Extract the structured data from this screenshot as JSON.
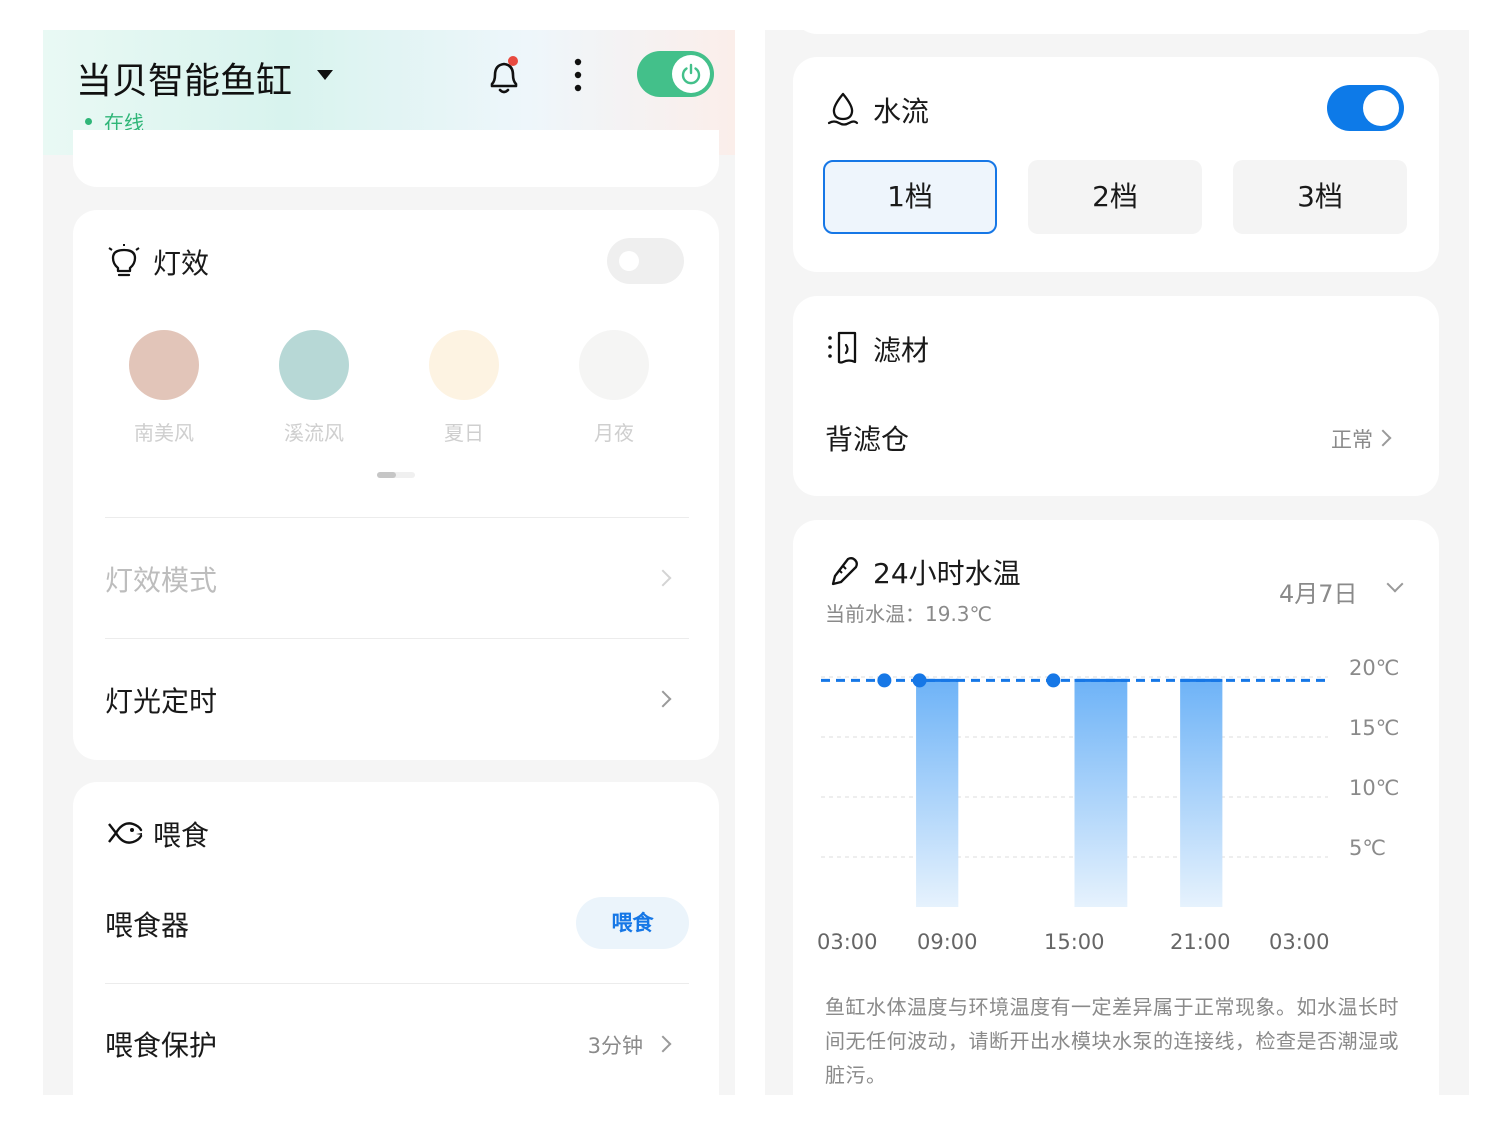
{
  "header": {
    "title": "当贝智能鱼缸",
    "status": "在线"
  },
  "light": {
    "title": "灯效",
    "presets": [
      {
        "label": "南美风",
        "color": "#e2c5b9"
      },
      {
        "label": "溪流风",
        "color": "#b7d8d6"
      },
      {
        "label": "夏日",
        "color": "#fdf3e2"
      },
      {
        "label": "月夜",
        "color": "#f5f5f4"
      }
    ],
    "mode_label": "灯效模式",
    "timer_label": "灯光定时"
  },
  "feeding": {
    "title": "喂食",
    "feeder_label": "喂食器",
    "feed_button": "喂食",
    "protection_label": "喂食保护",
    "protection_value": "3分钟"
  },
  "water_flow": {
    "title": "水流",
    "enabled": true,
    "levels": [
      "1档",
      "2档",
      "3档"
    ],
    "selected_level": "1档"
  },
  "filter": {
    "title": "滤材",
    "item_label": "背滤仓",
    "item_status": "正常"
  },
  "temperature": {
    "title": "24小时水温",
    "current": "当前水温：19.3℃",
    "date": "4月7日",
    "note": "鱼缸水体温度与环境温度有一定差异属于正常现象。如水温长时间无任何波动，请断开出水模块水泵的连接线，检查是否潮湿或脏污。"
  },
  "chart_data": {
    "type": "bar",
    "x": [
      "03:00",
      "09:00",
      "15:00",
      "21:00",
      "03:00"
    ],
    "y_ticks": [
      "20℃",
      "15℃",
      "10℃",
      "5℃"
    ],
    "ylim": [
      0,
      20
    ],
    "bars": [
      {
        "start": "06:30",
        "end": "08:30",
        "value": 19.3
      },
      {
        "start": "14:00",
        "end": "16:30",
        "value": 19.3
      },
      {
        "start": "19:00",
        "end": "21:00",
        "value": 19.3
      }
    ],
    "line_points": [
      {
        "x": "13:00",
        "value": 19.3
      },
      {
        "x": "05:00",
        "value": 19.3
      },
      {
        "x": "06:40",
        "value": 19.3
      }
    ],
    "grid": true
  }
}
